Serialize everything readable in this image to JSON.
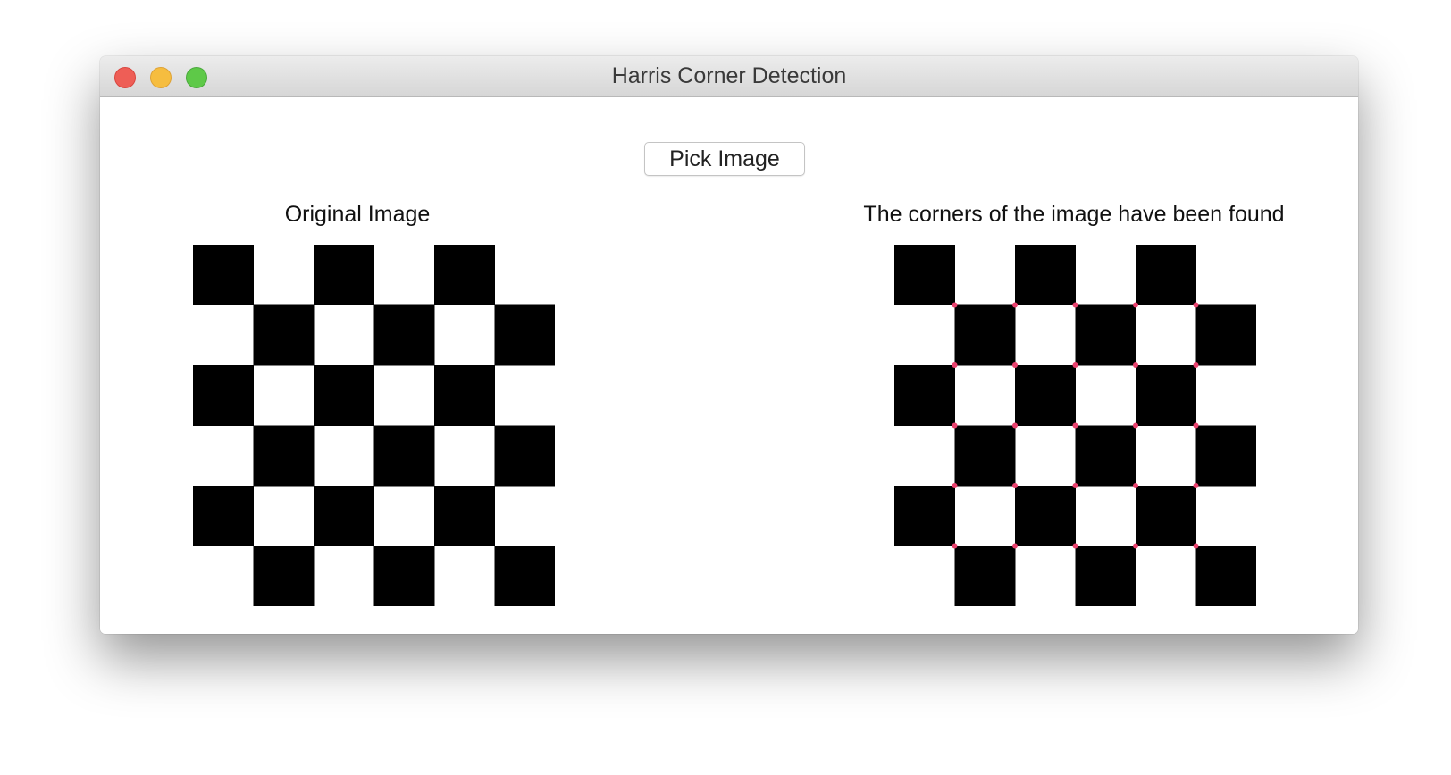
{
  "window": {
    "title": "Harris Corner Detection",
    "controls": {
      "close_color": "#ee5e56",
      "minimize_color": "#f6bd3f",
      "zoom_color": "#5ec948"
    }
  },
  "toolbar": {
    "pick_button_label": "Pick Image"
  },
  "original_panel": {
    "label": "Original Image",
    "grid": {
      "rows": 6,
      "cols": 6,
      "black_parity": "even"
    }
  },
  "result_panel": {
    "label": "The corners of the image have been found",
    "grid": {
      "rows": 6,
      "cols": 6,
      "black_parity": "even"
    },
    "corner_marker_color": "#e8426e",
    "interior_corner_count": 25
  }
}
